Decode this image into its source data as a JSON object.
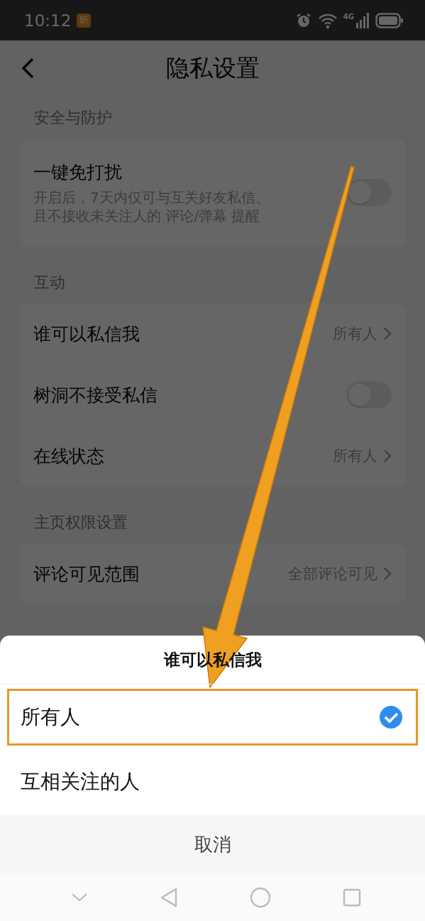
{
  "status_bar": {
    "time": "10:12",
    "app_badge": "听",
    "network": "4G"
  },
  "header": {
    "title": "隐私设置"
  },
  "sections": [
    {
      "title": "安全与防护",
      "rows": [
        {
          "kind": "toggle",
          "label": "一键免打扰",
          "description": "开启后，7天内仅可与互关好友私信、且不接收未关注人的 评论/弹幕 提醒",
          "on": false
        }
      ]
    },
    {
      "title": "互动",
      "rows": [
        {
          "kind": "link",
          "label": "谁可以私信我",
          "value": "所有人"
        },
        {
          "kind": "toggle",
          "label": "树洞不接受私信",
          "on": false
        },
        {
          "kind": "link",
          "label": "在线状态",
          "value": "所有人"
        }
      ]
    },
    {
      "title": "主页权限设置",
      "rows": [
        {
          "kind": "link",
          "label": "评论可见范围",
          "value": "全部评论可见"
        }
      ]
    }
  ],
  "sheet": {
    "title": "谁可以私信我",
    "options": [
      {
        "label": "所有人",
        "selected": true,
        "highlighted": true
      },
      {
        "label": "互相关注的人",
        "selected": false,
        "highlighted": false
      }
    ],
    "cancel": "取消"
  }
}
